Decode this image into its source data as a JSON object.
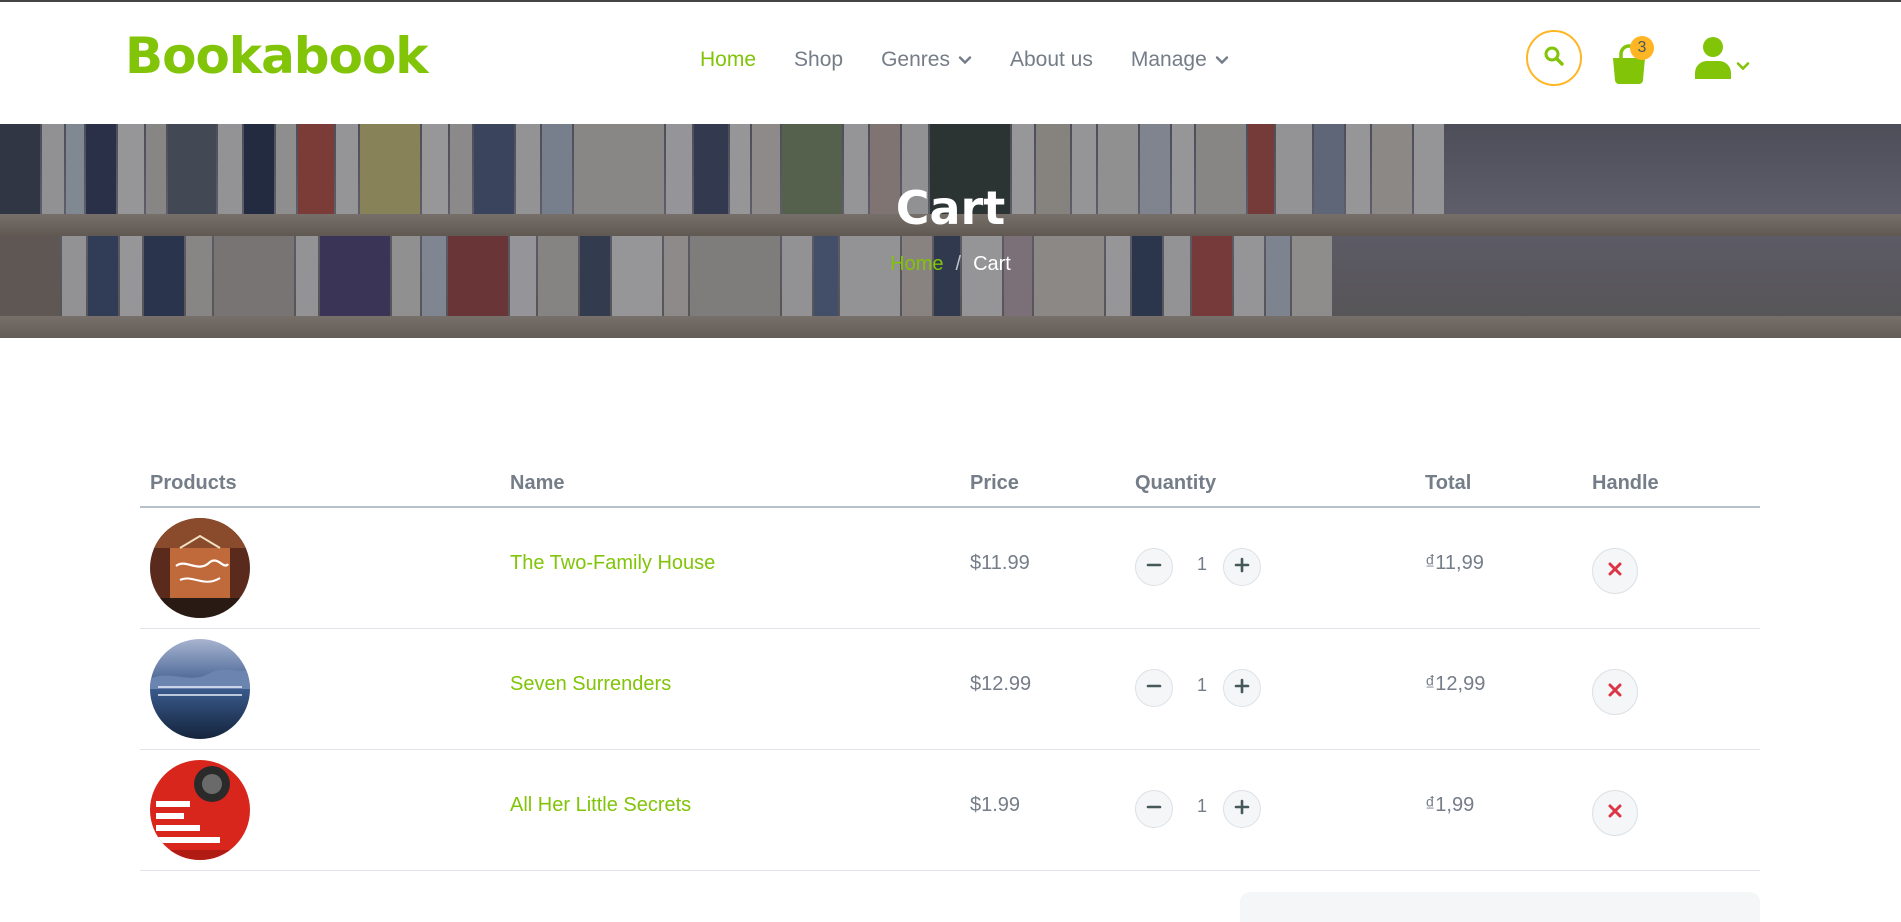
{
  "brand": {
    "name": "Bookabook",
    "accent": "#81c408",
    "secondary": "#ffb524",
    "text": "#747d88"
  },
  "nav": {
    "items": [
      {
        "label": "Home",
        "active": true,
        "dropdown": false
      },
      {
        "label": "Shop",
        "active": false,
        "dropdown": false
      },
      {
        "label": "Genres",
        "active": false,
        "dropdown": true
      },
      {
        "label": "About us",
        "active": false,
        "dropdown": false
      },
      {
        "label": "Manage",
        "active": false,
        "dropdown": true
      }
    ],
    "search_icon": "search-icon",
    "cart_icon": "shopping-bag-icon",
    "cart_count": "3",
    "user_icon": "user-icon"
  },
  "hero": {
    "title": "Cart",
    "breadcrumb": {
      "home": "Home",
      "separator": "/",
      "current": "Cart"
    }
  },
  "table": {
    "headers": {
      "products": "Products",
      "name": "Name",
      "price": "Price",
      "quantity": "Quantity",
      "total": "Total",
      "handle": "Handle"
    },
    "rows": [
      {
        "name": "The Two-Family House",
        "price": "$11.99",
        "quantity": "1",
        "total": "₫11,99"
      },
      {
        "name": "Seven Surrenders",
        "price": "$12.99",
        "quantity": "1",
        "total": "₫12,99"
      },
      {
        "name": "All Her Little Secrets",
        "price": "$1.99",
        "quantity": "1",
        "total": "₫1,99"
      }
    ]
  }
}
